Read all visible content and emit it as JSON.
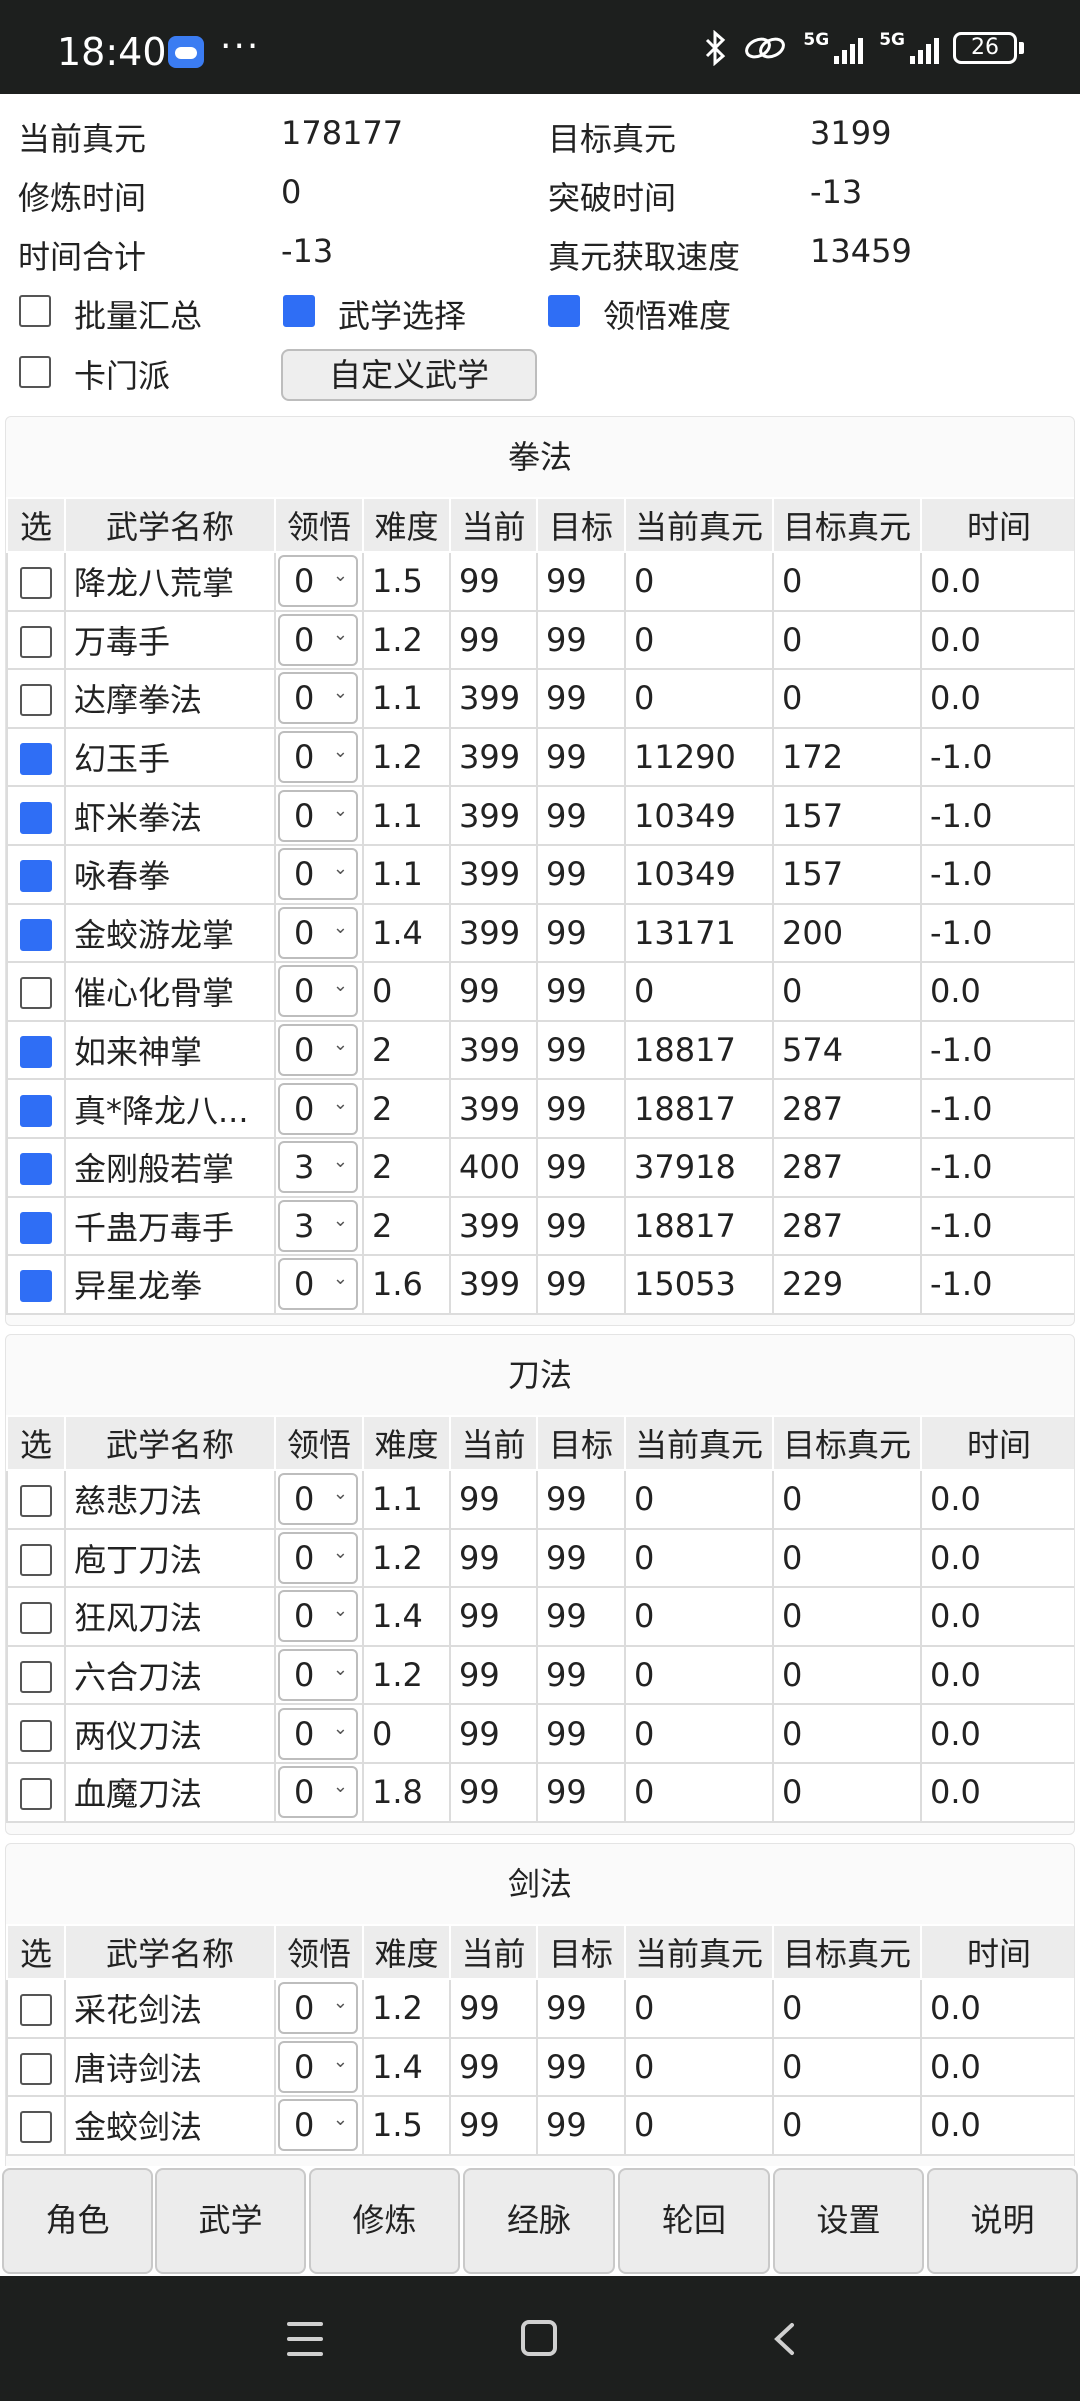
{
  "status_bar": {
    "time": "18:40",
    "more": "···",
    "network1": "5G",
    "network2": "5G",
    "battery": "26"
  },
  "summary": {
    "current_zhenyuan_label": "当前真元",
    "current_zhenyuan_value": "178177",
    "target_zhenyuan_label": "目标真元",
    "target_zhenyuan_value": "3199",
    "cultivation_time_label": "修炼时间",
    "cultivation_time_value": "0",
    "breakthrough_time_label": "突破时间",
    "breakthrough_time_value": "-13",
    "total_time_label": "时间合计",
    "total_time_value": "-13",
    "gain_speed_label": "真元获取速度",
    "gain_speed_value": "13459",
    "batch_summary_label": "批量汇总",
    "batch_summary_checked": false,
    "martial_select_label": "武学选择",
    "martial_select_checked": true,
    "comprehension_difficulty_label": "领悟难度",
    "comprehension_difficulty_checked": true,
    "card_sect_label": "卡门派",
    "card_sect_checked": false,
    "custom_martial_button": "自定义武学"
  },
  "table_headers": [
    "选",
    "武学名称",
    "领悟",
    "难度",
    "当前",
    "目标",
    "当前真元",
    "目标真元",
    "时间"
  ],
  "sections": [
    {
      "title": "拳法",
      "rows": [
        {
          "checked": false,
          "name": "降龙八荒掌",
          "wu": "0",
          "nd": "1.5",
          "cur": "99",
          "tgt": "99",
          "curzy": "0",
          "tgtzy": "0",
          "time": "0.0"
        },
        {
          "checked": false,
          "name": "万毒手",
          "wu": "0",
          "nd": "1.2",
          "cur": "99",
          "tgt": "99",
          "curzy": "0",
          "tgtzy": "0",
          "time": "0.0"
        },
        {
          "checked": false,
          "name": "达摩拳法",
          "wu": "0",
          "nd": "1.1",
          "cur": "399",
          "tgt": "99",
          "curzy": "0",
          "tgtzy": "0",
          "time": "0.0"
        },
        {
          "checked": true,
          "name": "幻玉手",
          "wu": "0",
          "nd": "1.2",
          "cur": "399",
          "tgt": "99",
          "curzy": "11290",
          "tgtzy": "172",
          "time": "-1.0"
        },
        {
          "checked": true,
          "name": "虾米拳法",
          "wu": "0",
          "nd": "1.1",
          "cur": "399",
          "tgt": "99",
          "curzy": "10349",
          "tgtzy": "157",
          "time": "-1.0"
        },
        {
          "checked": true,
          "name": "咏春拳",
          "wu": "0",
          "nd": "1.1",
          "cur": "399",
          "tgt": "99",
          "curzy": "10349",
          "tgtzy": "157",
          "time": "-1.0"
        },
        {
          "checked": true,
          "name": "金蛟游龙掌",
          "wu": "0",
          "nd": "1.4",
          "cur": "399",
          "tgt": "99",
          "curzy": "13171",
          "tgtzy": "200",
          "time": "-1.0"
        },
        {
          "checked": false,
          "name": "催心化骨掌",
          "wu": "0",
          "nd": "0",
          "cur": "99",
          "tgt": "99",
          "curzy": "0",
          "tgtzy": "0",
          "time": "0.0"
        },
        {
          "checked": true,
          "name": "如来神掌",
          "wu": "0",
          "nd": "2",
          "cur": "399",
          "tgt": "99",
          "curzy": "18817",
          "tgtzy": "574",
          "time": "-1.0"
        },
        {
          "checked": true,
          "name": "真*降龙八...",
          "wu": "0",
          "nd": "2",
          "cur": "399",
          "tgt": "99",
          "curzy": "18817",
          "tgtzy": "287",
          "time": "-1.0"
        },
        {
          "checked": true,
          "name": "金刚般若掌",
          "wu": "3",
          "nd": "2",
          "cur": "400",
          "tgt": "99",
          "curzy": "37918",
          "tgtzy": "287",
          "time": "-1.0"
        },
        {
          "checked": true,
          "name": "千蛊万毒手",
          "wu": "3",
          "nd": "2",
          "cur": "399",
          "tgt": "99",
          "curzy": "18817",
          "tgtzy": "287",
          "time": "-1.0"
        },
        {
          "checked": true,
          "name": "异星龙拳",
          "wu": "0",
          "nd": "1.6",
          "cur": "399",
          "tgt": "99",
          "curzy": "15053",
          "tgtzy": "229",
          "time": "-1.0"
        }
      ]
    },
    {
      "title": "刀法",
      "rows": [
        {
          "checked": false,
          "name": "慈悲刀法",
          "wu": "0",
          "nd": "1.1",
          "cur": "99",
          "tgt": "99",
          "curzy": "0",
          "tgtzy": "0",
          "time": "0.0"
        },
        {
          "checked": false,
          "name": "庖丁刀法",
          "wu": "0",
          "nd": "1.2",
          "cur": "99",
          "tgt": "99",
          "curzy": "0",
          "tgtzy": "0",
          "time": "0.0"
        },
        {
          "checked": false,
          "name": "狂风刀法",
          "wu": "0",
          "nd": "1.4",
          "cur": "99",
          "tgt": "99",
          "curzy": "0",
          "tgtzy": "0",
          "time": "0.0"
        },
        {
          "checked": false,
          "name": "六合刀法",
          "wu": "0",
          "nd": "1.2",
          "cur": "99",
          "tgt": "99",
          "curzy": "0",
          "tgtzy": "0",
          "time": "0.0"
        },
        {
          "checked": false,
          "name": "两仪刀法",
          "wu": "0",
          "nd": "0",
          "cur": "99",
          "tgt": "99",
          "curzy": "0",
          "tgtzy": "0",
          "time": "0.0"
        },
        {
          "checked": false,
          "name": "血魔刀法",
          "wu": "0",
          "nd": "1.8",
          "cur": "99",
          "tgt": "99",
          "curzy": "0",
          "tgtzy": "0",
          "time": "0.0"
        }
      ]
    },
    {
      "title": "剑法",
      "rows": [
        {
          "checked": false,
          "name": "采花剑法",
          "wu": "0",
          "nd": "1.2",
          "cur": "99",
          "tgt": "99",
          "curzy": "0",
          "tgtzy": "0",
          "time": "0.0"
        },
        {
          "checked": false,
          "name": "唐诗剑法",
          "wu": "0",
          "nd": "1.4",
          "cur": "99",
          "tgt": "99",
          "curzy": "0",
          "tgtzy": "0",
          "time": "0.0"
        },
        {
          "checked": false,
          "name": "金蛟剑法",
          "wu": "0",
          "nd": "1.5",
          "cur": "99",
          "tgt": "99",
          "curzy": "0",
          "tgtzy": "0",
          "time": "0.0"
        }
      ]
    }
  ],
  "tabs": [
    "角色",
    "武学",
    "修炼",
    "经脉",
    "轮回",
    "设置",
    "说明"
  ]
}
